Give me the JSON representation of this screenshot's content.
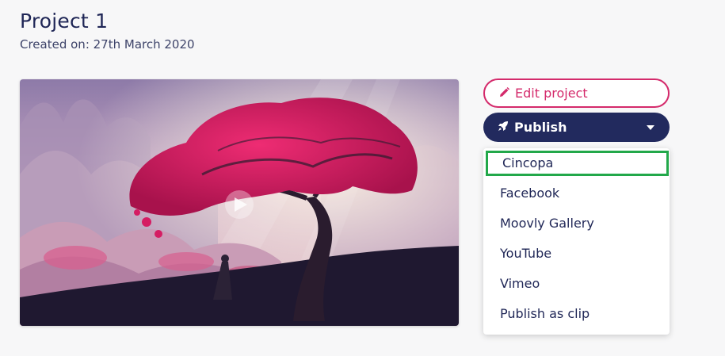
{
  "project": {
    "title": "Project 1",
    "created": "Created on: 27th March 2020"
  },
  "video": {
    "thumbnail_icon": "play-icon"
  },
  "actions": {
    "edit_label": "Edit project",
    "edit_icon": "pencil-icon",
    "publish_label": "Publish",
    "publish_icon": "rocket-icon",
    "accent_color": "#d42a6b",
    "primary_color": "#222a5e"
  },
  "publish_menu": {
    "items": [
      {
        "label": "Cincopa",
        "highlighted": true
      },
      {
        "label": "Facebook"
      },
      {
        "label": "Moovly Gallery"
      },
      {
        "label": "YouTube"
      },
      {
        "label": "Vimeo"
      },
      {
        "label": "Publish as clip"
      }
    ],
    "highlight_color": "#22a84a"
  }
}
